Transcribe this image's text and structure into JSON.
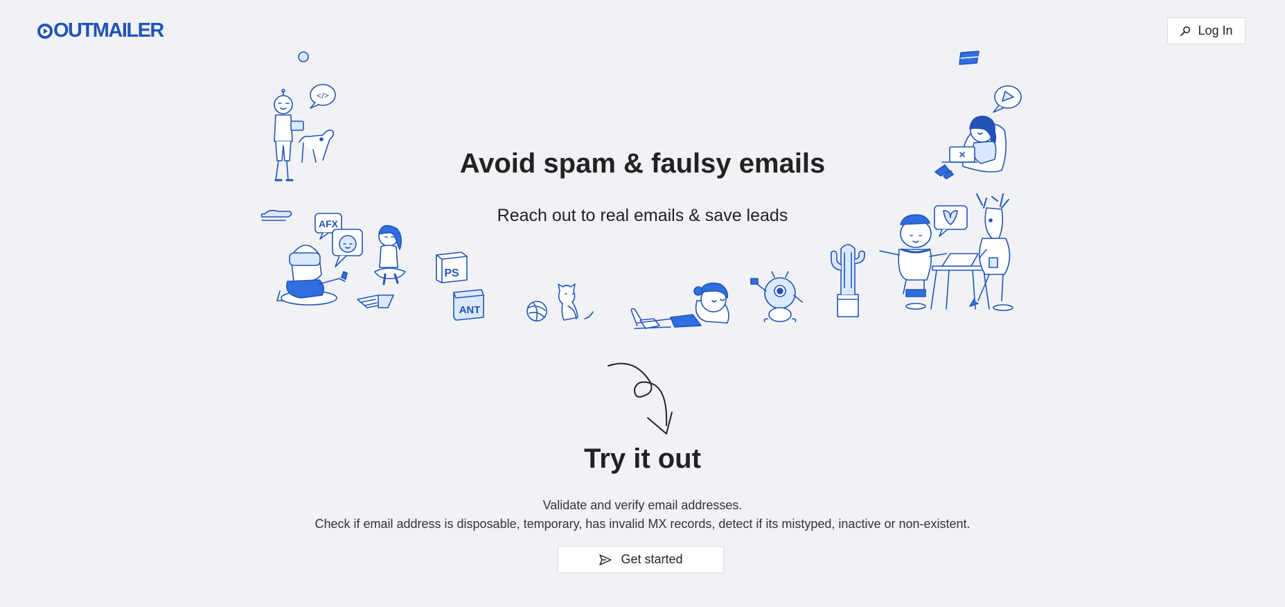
{
  "header": {
    "logo_text": "OUTMAILER",
    "login_label": "Log In",
    "login_icon": "search-icon"
  },
  "hero": {
    "title": "Avoid spam & faulsy emails",
    "subtitle": "Reach out to real emails & save leads",
    "illustration_labels": {
      "code_bubble": "</>",
      "afx_bubble": "AFX",
      "ps_cube": "PS",
      "ant_cube": "ANT"
    }
  },
  "try_section": {
    "title": "Try it out",
    "line1": "Validate and verify email addresses.",
    "line2": "Check if email address is disposable, temporary, has invalid MX records, detect if its mistyped, inactive or non-existent.",
    "cta_label": "Get started",
    "cta_icon": "send-icon"
  },
  "colors": {
    "brand": "#2153b8",
    "accent": "#2f6fe0",
    "background": "#f0f2f6",
    "light_fill": "#dbe9ff"
  }
}
